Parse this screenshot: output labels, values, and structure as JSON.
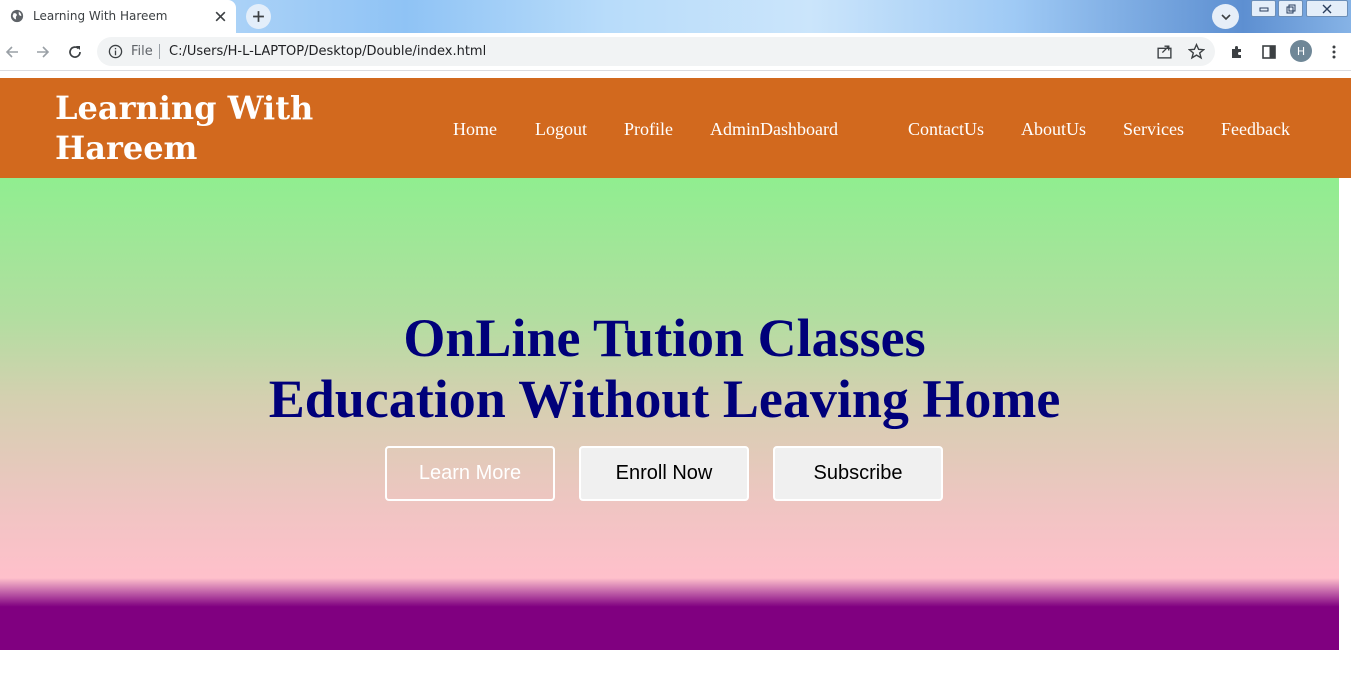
{
  "browser": {
    "tab": {
      "title": "Learning With Hareem",
      "icon": "globe-icon"
    },
    "omnibox": {
      "scheme_label": "File",
      "url": "C:/Users/H-L-LAPTOP/Desktop/Double/index.html"
    },
    "profile_initial": "H"
  },
  "site": {
    "brand": "Learning With Hareem",
    "nav": [
      "Home",
      "Logout",
      "Profile",
      "AdminDashboard",
      "ContactUs",
      "AboutUs",
      "Services",
      "Feedback"
    ],
    "colors": {
      "header": "#d2691e",
      "hero_title": "#00007a",
      "footer": "#800080"
    }
  },
  "hero": {
    "title_line1": "OnLine Tution Classes",
    "title_line2": "Education Without Leaving Home",
    "buttons": {
      "learn_more": "Learn More",
      "enroll_now": "Enroll Now",
      "subscribe": "Subscribe"
    }
  }
}
